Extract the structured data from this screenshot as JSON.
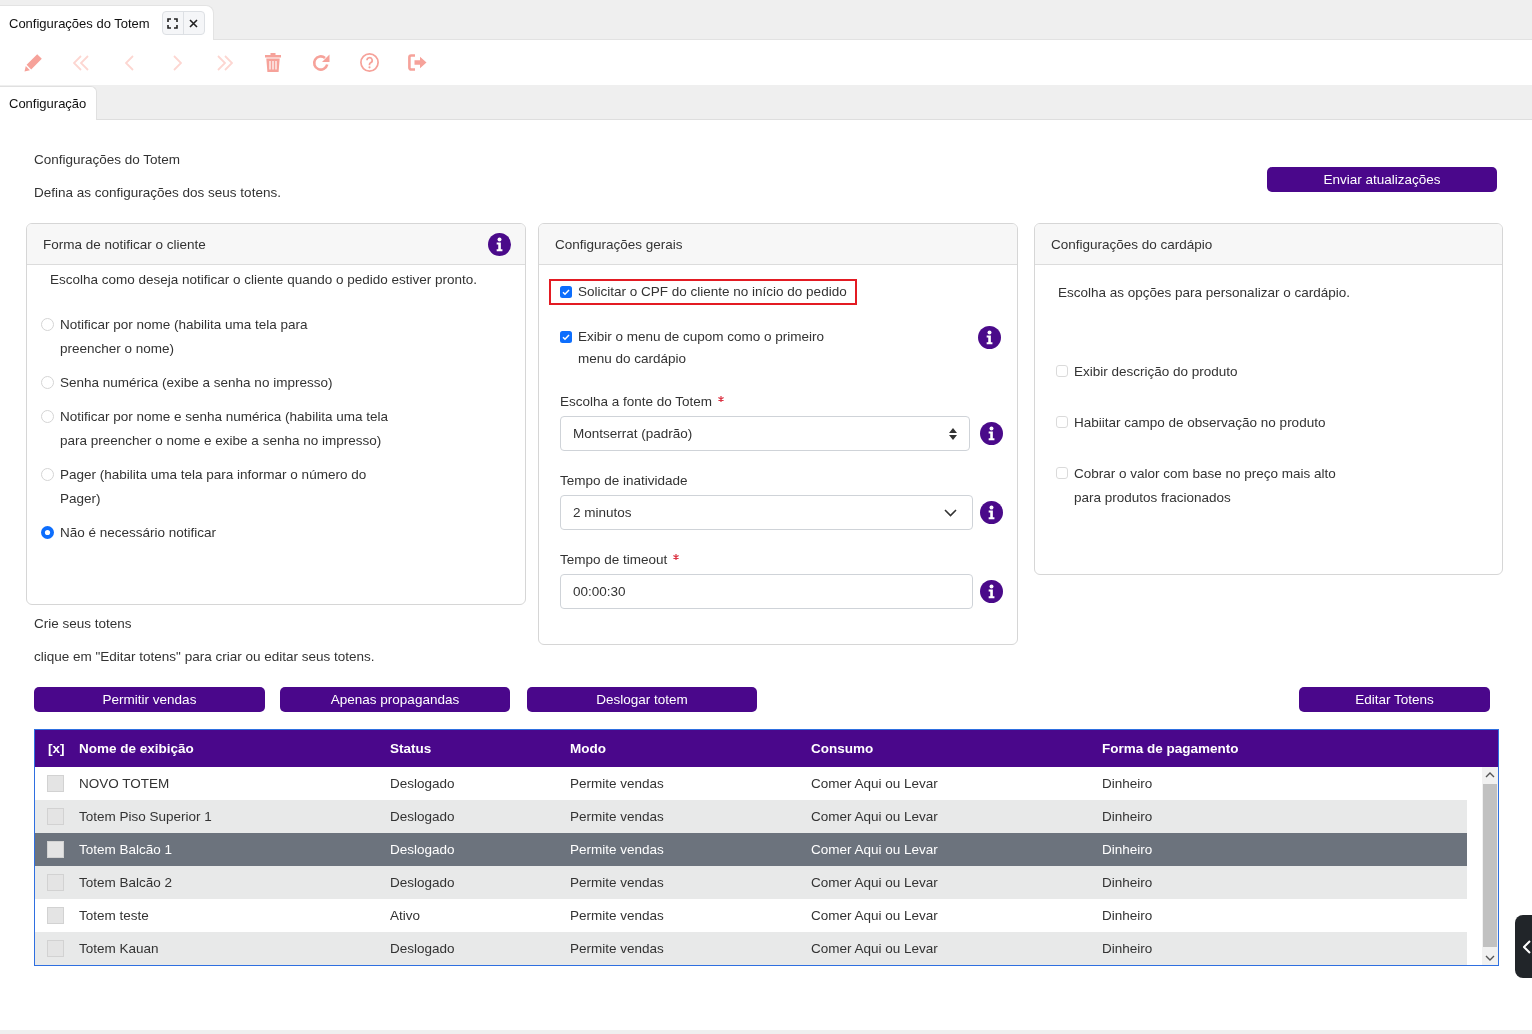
{
  "window_tabs": [
    {
      "label": "Configurações do Totem",
      "selected": true
    }
  ],
  "toolbar": [
    {
      "kind": "edit",
      "disabled": false
    },
    {
      "kind": "first",
      "disabled": true
    },
    {
      "kind": "previous",
      "disabled": true
    },
    {
      "kind": "next",
      "disabled": true
    },
    {
      "kind": "last",
      "disabled": true
    },
    {
      "kind": "delete",
      "disabled": false
    },
    {
      "kind": "refresh",
      "disabled": false
    },
    {
      "kind": "help",
      "disabled": false
    },
    {
      "kind": "exit",
      "disabled": false
    }
  ],
  "section_tabs": [
    {
      "label": "Configuração",
      "selected": true
    }
  ],
  "page_header": {
    "title": "Configurações do Totem",
    "subtitle": "Defina as configurações dos seus totens.",
    "action_button": "Enviar atualizações"
  },
  "notification_card": {
    "title": "Forma de notificar o cliente",
    "info": true,
    "description": "Escolha como deseja notificar o cliente quando o pedido estiver pronto.",
    "options": [
      {
        "label": "Notificar por nome (habilita uma tela para\npreencher o nome)",
        "selected": false
      },
      {
        "label": "Senha numérica (exibe a senha no impresso)",
        "selected": false
      },
      {
        "label": "Notificar por nome e senha numérica (habilita uma tela\npara preencher o nome e exibe a senha no impresso)",
        "selected": false
      },
      {
        "label": "Pager (habilita uma tela para informar o número do\nPager)",
        "selected": false
      },
      {
        "label": "Não é necessário notificar",
        "selected": true
      }
    ]
  },
  "general_card": {
    "title": "Configurações gerais",
    "options": [
      {
        "label": "Solicitar o CPF do cliente no início do pedido",
        "checked": true,
        "highlighted": true,
        "info": false
      },
      {
        "label": "Exibir o menu de cupom como o primeiro\nmenu do cardápio",
        "checked": true,
        "highlighted": false,
        "info": true
      }
    ],
    "fields": [
      {
        "kind": "picker",
        "label": "Escolha a fonte do Totem",
        "required": true,
        "value": "Montserrat (padrão)",
        "info": true
      },
      {
        "kind": "dropdown",
        "label": "Tempo de inatividade",
        "required": false,
        "value": "2 minutos",
        "info": true
      },
      {
        "kind": "text",
        "label": "Tempo de timeout",
        "required": true,
        "value": "00:00:30",
        "info": true
      }
    ]
  },
  "menu_card": {
    "title": "Configurações do cardápio",
    "description": "Escolha as opções para personalizar o cardápio.",
    "options": [
      {
        "label": "Exibir descrição do produto",
        "checked": false
      },
      {
        "label": "Habiitar campo de observação no produto",
        "checked": false
      },
      {
        "label": "Cobrar o valor com base no preço mais alto\npara produtos fracionados",
        "checked": false
      }
    ]
  },
  "totems_section": {
    "title": "Crie seus totens",
    "hint": "clique em \"Editar totens\" para criar ou editar seus totens.",
    "buttons": [
      "Permitir vendas",
      "Apenas propagandas",
      "Deslogar totem"
    ],
    "edit_button": "Editar Totens"
  },
  "table": {
    "select_all": "[x]",
    "columns": [
      "Nome de exibição",
      "Status",
      "Modo",
      "Consumo",
      "Forma de pagamento"
    ],
    "rows": [
      {
        "checked": false,
        "selected": false,
        "cells": [
          "NOVO TOTEM",
          "Deslogado",
          "Permite vendas",
          "Comer Aqui ou Levar",
          "Dinheiro"
        ]
      },
      {
        "checked": false,
        "selected": false,
        "cells": [
          "Totem Piso Superior 1",
          "Deslogado",
          "Permite vendas",
          "Comer Aqui ou Levar",
          "Dinheiro"
        ]
      },
      {
        "checked": false,
        "selected": true,
        "cells": [
          "Totem Balcão 1",
          "Deslogado",
          "Permite vendas",
          "Comer Aqui ou Levar",
          "Dinheiro"
        ]
      },
      {
        "checked": false,
        "selected": false,
        "cells": [
          "Totem Balcão 2",
          "Deslogado",
          "Permite vendas",
          "Comer Aqui ou Levar",
          "Dinheiro"
        ]
      },
      {
        "checked": false,
        "selected": false,
        "cells": [
          "Totem teste",
          "Ativo",
          "Permite vendas",
          "Comer Aqui ou Levar",
          "Dinheiro"
        ]
      },
      {
        "checked": false,
        "selected": false,
        "cells": [
          "Totem Kauan",
          "Deslogado",
          "Permite vendas",
          "Comer Aqui ou Levar",
          "Dinheiro"
        ]
      }
    ]
  }
}
